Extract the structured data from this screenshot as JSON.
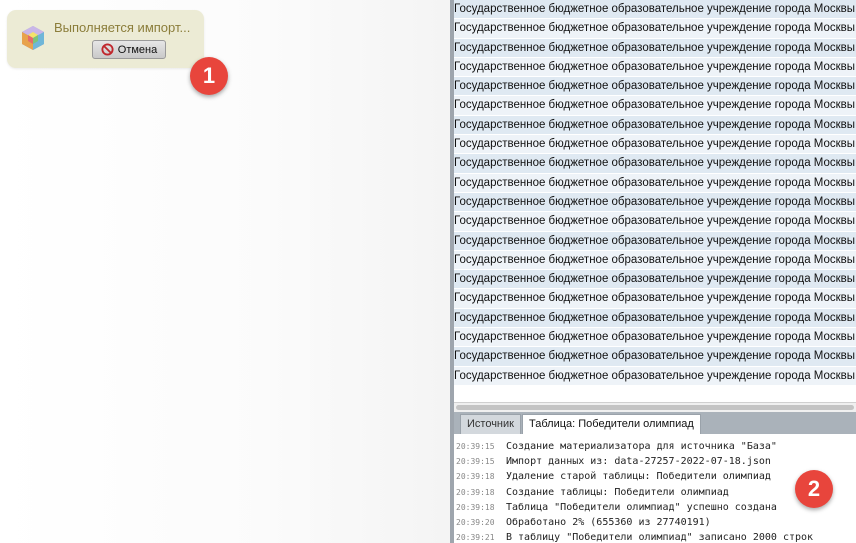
{
  "import_toast": {
    "status_text": "Выполняется импорт...",
    "cancel_label": "Отмена"
  },
  "badges": {
    "badge_1": "1",
    "badge_2": "2"
  },
  "table": {
    "rows": [
      "Государственное бюджетное образовательное учреждение города Москвы сре",
      "Государственное бюджетное образовательное учреждение города Москвы сре",
      "Государственное бюджетное образовательное учреждение города Москвы сре",
      "Государственное бюджетное образовательное учреждение города Москвы сре",
      "Государственное бюджетное образовательное учреждение города Москвы сре",
      "Государственное бюджетное образовательное учреждение города Москвы сре",
      "Государственное бюджетное образовательное учреждение города Москвы сре",
      "Государственное бюджетное образовательное учреждение города Москвы сре",
      "Государственное бюджетное образовательное учреждение города Москвы сре",
      "Государственное бюджетное образовательное учреждение города Москвы сре",
      "Государственное бюджетное образовательное учреждение города Москвы сре",
      "Государственное бюджетное образовательное учреждение города Москвы сре",
      "Государственное бюджетное образовательное учреждение города Москвы сре",
      "Государственное бюджетное образовательное учреждение города Москвы сре",
      "Государственное бюджетное образовательное учреждение города Москвы гим",
      "Государственное бюджетное образовательное учреждение города Москвы гим",
      "Государственное бюджетное образовательное учреждение города Москвы сре",
      "Государственное бюджетное образовательное учреждение города Москвы сре",
      "Государственное бюджетное образовательное учреждение города Москвы сре",
      "Государственное бюджетное образовательное учреждение города Москвы сре"
    ]
  },
  "tabs": {
    "source": "Источник",
    "table": "Таблица: Победители олимпиад"
  },
  "log": [
    {
      "time": "20:39:15",
      "text": "Создание материализатора для источника \"База\""
    },
    {
      "time": "20:39:15",
      "text": "Импорт данных из: data-27257-2022-07-18.json"
    },
    {
      "time": "20:39:18",
      "text": "Удаление старой таблицы: Победители олимпиад"
    },
    {
      "time": "20:39:18",
      "text": "Создание таблицы: Победители олимпиад"
    },
    {
      "time": "20:39:18",
      "text": "Таблица \"Победители олимпиад\" успешно создана"
    },
    {
      "time": "20:39:20",
      "text": "Обработано 2% (655360 из 27740191)"
    },
    {
      "time": "20:39:21",
      "text": "В таблицу \"Победители олимпиад\" записано 2000 строк"
    }
  ]
}
